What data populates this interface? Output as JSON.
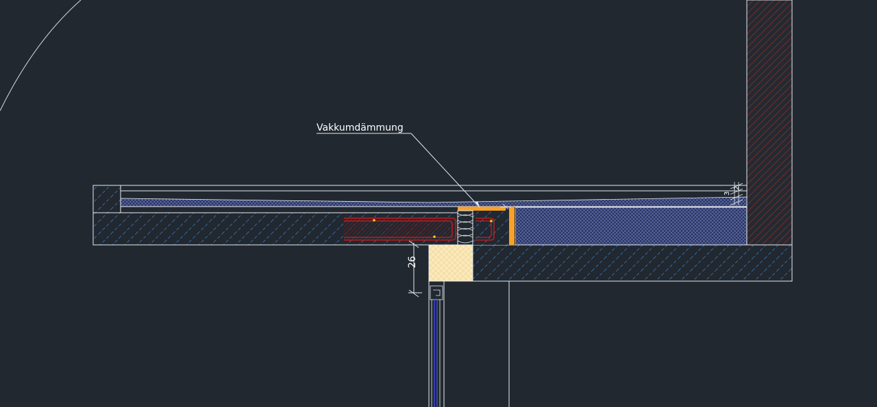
{
  "viewport": {
    "background": "#212830"
  },
  "annotations": {
    "label": "Vakkumdämmung",
    "dimension_vertical": "26",
    "dimension_small_a": "3",
    "dimension_small_b": "2"
  },
  "colors": {
    "line": "#e8ecf0",
    "concrete_hatch": "#3a74b4",
    "insulation_fill": "#5a6ea8",
    "brick_hatch": "#8a2a2a",
    "rebar": "#b81e1e",
    "orange_insulation": "#f7a128",
    "timber": "#fbe9b8",
    "glass": "#3a46d8",
    "rebar_dot": "#f2d21e"
  }
}
